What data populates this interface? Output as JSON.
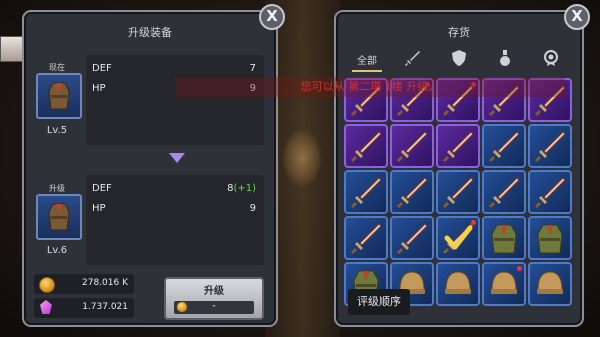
{
  "equip_panel": {
    "title": "升级装备",
    "current_label": "现在",
    "current_level": "Lv.5",
    "current_stats": [
      {
        "name": "DEF",
        "value": "7",
        "bonus": ""
      },
      {
        "name": "HP",
        "value": "9",
        "bonus": ""
      }
    ],
    "upgrade_label": "升级",
    "next_level": "Lv.6",
    "next_stats": [
      {
        "name": "DEF",
        "value": "8",
        "bonus": "(+1)"
      },
      {
        "name": "HP",
        "value": "9",
        "bonus": ""
      }
    ],
    "gold": "278.016 K",
    "gems": "1.737.021",
    "upgrade_button": {
      "label": "升级",
      "cost": "-"
    },
    "close": "X"
  },
  "inventory_panel": {
    "title": "存货",
    "tabs": [
      {
        "label": "全部",
        "icon": "all"
      },
      {
        "label": "",
        "icon": "sword-icon"
      },
      {
        "label": "",
        "icon": "shield-icon"
      },
      {
        "label": "",
        "icon": "potion-icon"
      },
      {
        "label": "",
        "icon": "medal-icon"
      }
    ],
    "sort_button": "评级顺序",
    "close": "X",
    "grid": [
      [
        {
          "type": "sword",
          "rarity": "rare",
          "new": false
        },
        {
          "type": "sword",
          "rarity": "rare",
          "new": true
        },
        {
          "type": "sword",
          "rarity": "rare",
          "new": true
        },
        {
          "type": "sword",
          "rarity": "rare",
          "new": false
        },
        {
          "type": "sword",
          "rarity": "rare",
          "new": false
        }
      ],
      [
        {
          "type": "sword",
          "rarity": "rare",
          "new": false
        },
        {
          "type": "sword",
          "rarity": "rare",
          "new": false
        },
        {
          "type": "sword",
          "rarity": "rare",
          "new": false
        },
        {
          "type": "sword",
          "rarity": "blue",
          "new": false
        },
        {
          "type": "sword",
          "rarity": "blue",
          "new": false
        }
      ],
      [
        {
          "type": "sword",
          "rarity": "blue",
          "new": false
        },
        {
          "type": "sword",
          "rarity": "blue",
          "new": false
        },
        {
          "type": "sword",
          "rarity": "blue",
          "new": false
        },
        {
          "type": "sword",
          "rarity": "blue",
          "new": false
        },
        {
          "type": "sword",
          "rarity": "blue",
          "new": false
        }
      ],
      [
        {
          "type": "sword",
          "rarity": "blue",
          "new": false
        },
        {
          "type": "sword",
          "rarity": "blue",
          "new": false
        },
        {
          "type": "sword",
          "rarity": "blue",
          "new": true,
          "equipped": true
        },
        {
          "type": "robe",
          "rarity": "blue",
          "new": false
        },
        {
          "type": "robe",
          "rarity": "blue",
          "new": false
        }
      ],
      [
        {
          "type": "robe",
          "rarity": "blue",
          "new": false
        },
        {
          "type": "helmet",
          "rarity": "blue",
          "new": false
        },
        {
          "type": "helmet",
          "rarity": "blue",
          "new": false
        },
        {
          "type": "helmet",
          "rarity": "blue",
          "new": true
        },
        {
          "type": "helmet",
          "rarity": "blue",
          "new": false
        }
      ]
    ]
  },
  "toast": "您可以从 第二塔 1楼 升级。",
  "colors": {
    "rare": "#5c2aa0",
    "blue": "#244e97",
    "bonus": "#5cdd4a",
    "toast": "#cf3232"
  }
}
